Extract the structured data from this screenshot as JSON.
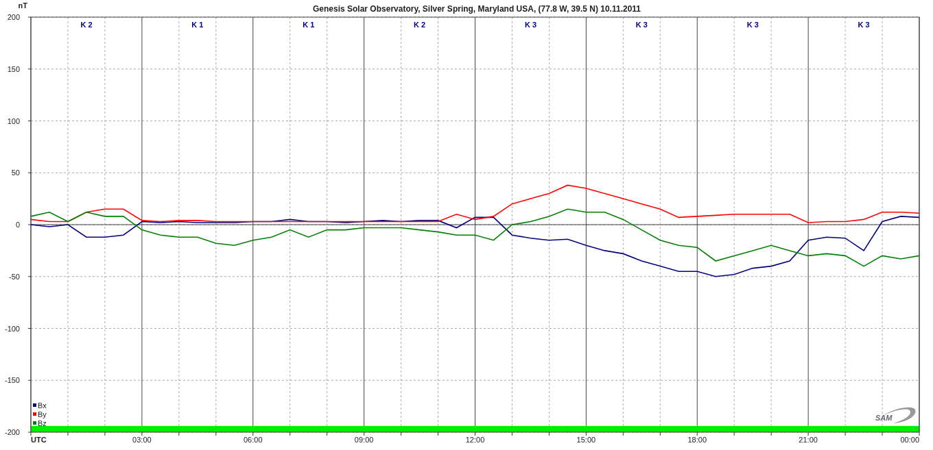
{
  "chart_data": {
    "type": "line",
    "title": "Genesis Solar Observatory, Silver Spring, Maryland USA, (77.8 W, 39.5 N)  10.11.2011",
    "ylabel": "nT",
    "x": [
      0,
      0.5,
      1,
      1.5,
      2,
      2.5,
      3,
      3.5,
      4,
      4.5,
      5,
      5.5,
      6,
      6.5,
      7,
      7.5,
      8,
      8.5,
      9,
      9.5,
      10,
      10.5,
      11,
      11.5,
      12,
      12.5,
      13,
      13.5,
      14,
      14.5,
      15,
      15.5,
      16,
      16.5,
      17,
      17.5,
      18,
      18.5,
      19,
      19.5,
      20,
      20.5,
      21,
      21.5,
      22,
      22.5,
      23,
      23.5,
      24
    ],
    "series": [
      {
        "name": "Bx",
        "color": "#000080",
        "values": [
          0,
          -2,
          0,
          -12,
          -12,
          -10,
          3,
          2,
          3,
          2,
          2,
          2,
          3,
          3,
          5,
          3,
          3,
          2,
          3,
          4,
          3,
          4,
          4,
          -3,
          7,
          7,
          -10,
          -13,
          -15,
          -14,
          -20,
          -25,
          -28,
          -35,
          -40,
          -45,
          -45,
          -50,
          -48,
          -42,
          -40,
          -35,
          -15,
          -12,
          -13,
          -25,
          3,
          8,
          7
        ]
      },
      {
        "name": "By",
        "color": "#ff0000",
        "values": [
          5,
          3,
          3,
          12,
          15,
          15,
          4,
          3,
          4,
          4,
          3,
          3,
          3,
          3,
          3,
          3,
          3,
          3,
          3,
          3,
          3,
          3,
          3,
          10,
          5,
          8,
          20,
          25,
          30,
          38,
          35,
          30,
          25,
          20,
          15,
          7,
          8,
          9,
          10,
          10,
          10,
          10,
          2,
          3,
          3,
          5,
          12,
          12,
          11
        ]
      },
      {
        "name": "Bz",
        "color": "#008000",
        "values": [
          8,
          12,
          3,
          12,
          8,
          8,
          -5,
          -10,
          -12,
          -12,
          -18,
          -20,
          -15,
          -12,
          -5,
          -12,
          -5,
          -5,
          -3,
          -3,
          -3,
          -5,
          -7,
          -10,
          -10,
          -15,
          0,
          3,
          8,
          15,
          12,
          12,
          5,
          -5,
          -15,
          -20,
          -22,
          -35,
          -30,
          -25,
          -20,
          -25,
          -30,
          -28,
          -30,
          -40,
          -30,
          -33,
          -30
        ]
      }
    ],
    "grid": true,
    "bands": [
      {
        "axis": "y",
        "from": -200,
        "to": -194,
        "color": "#00ee00"
      }
    ],
    "legend": "lower left",
    "xlim": [
      0,
      24
    ],
    "ylim": [
      -200,
      200
    ],
    "xticks": [
      {
        "value": 0,
        "label": "UTC"
      },
      {
        "value": 3,
        "label": "03:00"
      },
      {
        "value": 6,
        "label": "06:00"
      },
      {
        "value": 9,
        "label": "09:00"
      },
      {
        "value": 12,
        "label": "12:00"
      },
      {
        "value": 15,
        "label": "15:00"
      },
      {
        "value": 18,
        "label": "18:00"
      },
      {
        "value": 21,
        "label": "21:00"
      },
      {
        "value": 24,
        "label": "00:00"
      }
    ],
    "yticks": [
      -200,
      -150,
      -100,
      -50,
      0,
      50,
      100,
      150,
      200
    ],
    "annotations": [
      "K 2",
      "K 1",
      "K 1",
      "K 2",
      "K 3",
      "K 3",
      "K 3",
      "K 3"
    ]
  },
  "logo": "SAM"
}
